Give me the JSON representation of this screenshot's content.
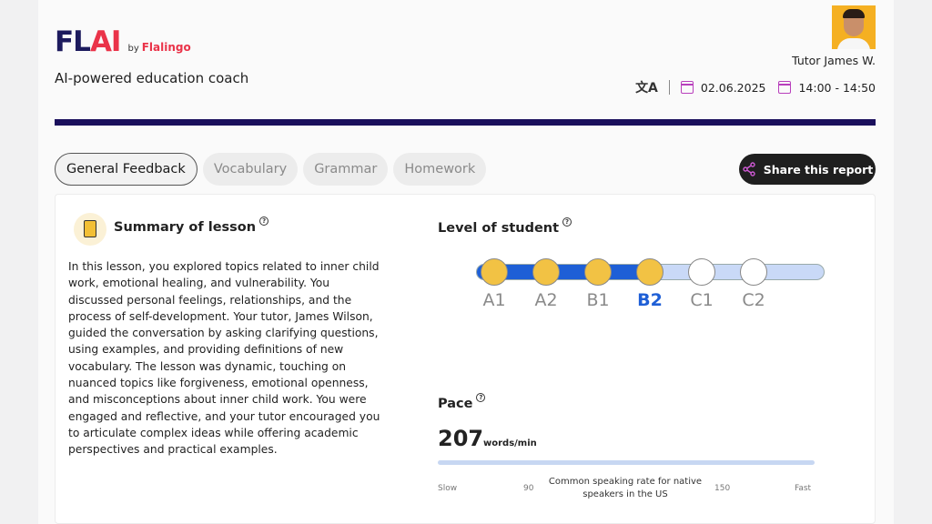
{
  "brand": {
    "logo_left": "FL",
    "logo_right": "AI",
    "by": "by",
    "brand_name": "Flalingo",
    "tagline": "AI-powered education coach"
  },
  "header": {
    "tutor": "Tutor James W.",
    "date": "02.06.2025",
    "time": "14:00 - 14:50",
    "translate_icon": "translate-icon"
  },
  "tabs": [
    {
      "label": "General Feedback",
      "active": true
    },
    {
      "label": "Vocabulary",
      "active": false
    },
    {
      "label": "Grammar",
      "active": false
    },
    {
      "label": "Homework",
      "active": false
    }
  ],
  "share": {
    "label": "Share this report"
  },
  "summary": {
    "title": "Summary of lesson",
    "text": "In this lesson, you explored topics related to inner child work, emotional healing, and vulnerability. You discussed personal feelings, relationships, and the process of self-development. Your tutor, James Wilson, guided the conversation by asking clarifying questions, using examples, and providing definitions of new vocabulary. The lesson was dynamic, touching on nuanced topics like forgiveness, emotional openness, and misconceptions about inner child work. You were engaged and reflective, and your tutor encouraged you to articulate complex ideas while offering academic perspectives and practical examples."
  },
  "level": {
    "title": "Level of student",
    "levels": [
      "A1",
      "A2",
      "B1",
      "B2",
      "C1",
      "C2"
    ],
    "current": "B2",
    "achieved_count": 4
  },
  "pace": {
    "title": "Pace",
    "value": "207",
    "unit": "words/min",
    "slow": "Slow",
    "low_mark": "90",
    "reference": "Common speaking rate for native speakers in the US",
    "high_mark": "150",
    "fast": "Fast"
  },
  "colors": {
    "navy": "#1a0f5c",
    "brand_red": "#ea3349",
    "accent_blue": "#1e5fd6",
    "dot_yellow": "#f2c244",
    "calendar_pink": "#b83fbc"
  }
}
